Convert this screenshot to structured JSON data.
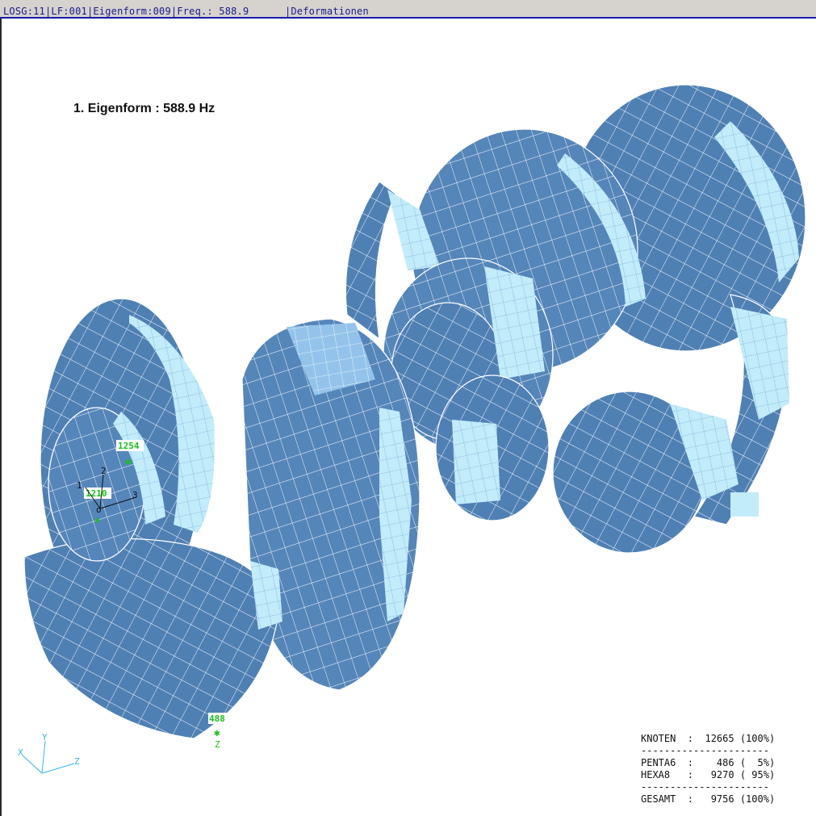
{
  "statusbar": {
    "text": "LOSG:11|LF:001|Eigenform:009|Freq.: 588.9      |Deformationen"
  },
  "viewport": {
    "title": "1. Eigenform : 588.9 Hz"
  },
  "node_labels": [
    {
      "id": "1254"
    },
    {
      "id": "1210"
    },
    {
      "id": "488"
    }
  ],
  "local_axes": [
    "1",
    "2",
    "3"
  ],
  "node_mark_z": "Z",
  "global_axes": {
    "x": "X",
    "y": "Y",
    "z": "Z"
  },
  "stats": {
    "rows": [
      {
        "label": "KNOTEN",
        "value": "12665 (100%)"
      },
      {
        "label": "PENTA6",
        "value": "  486 (  5%)"
      },
      {
        "label": "HEXA8 ",
        "value": " 9270 ( 95%)"
      },
      {
        "label": "GESAMT",
        "value": " 9756 (100%)"
      }
    ],
    "separator": "----------------------"
  },
  "colors": {
    "mesh_face": "#4f80b4",
    "mesh_face_light": "#c2ecfa",
    "mesh_face_mid": "#93c3ea",
    "mesh_edge": "#ffffff",
    "label_green": "#19c219",
    "status_bar": "#d6d3ce"
  }
}
